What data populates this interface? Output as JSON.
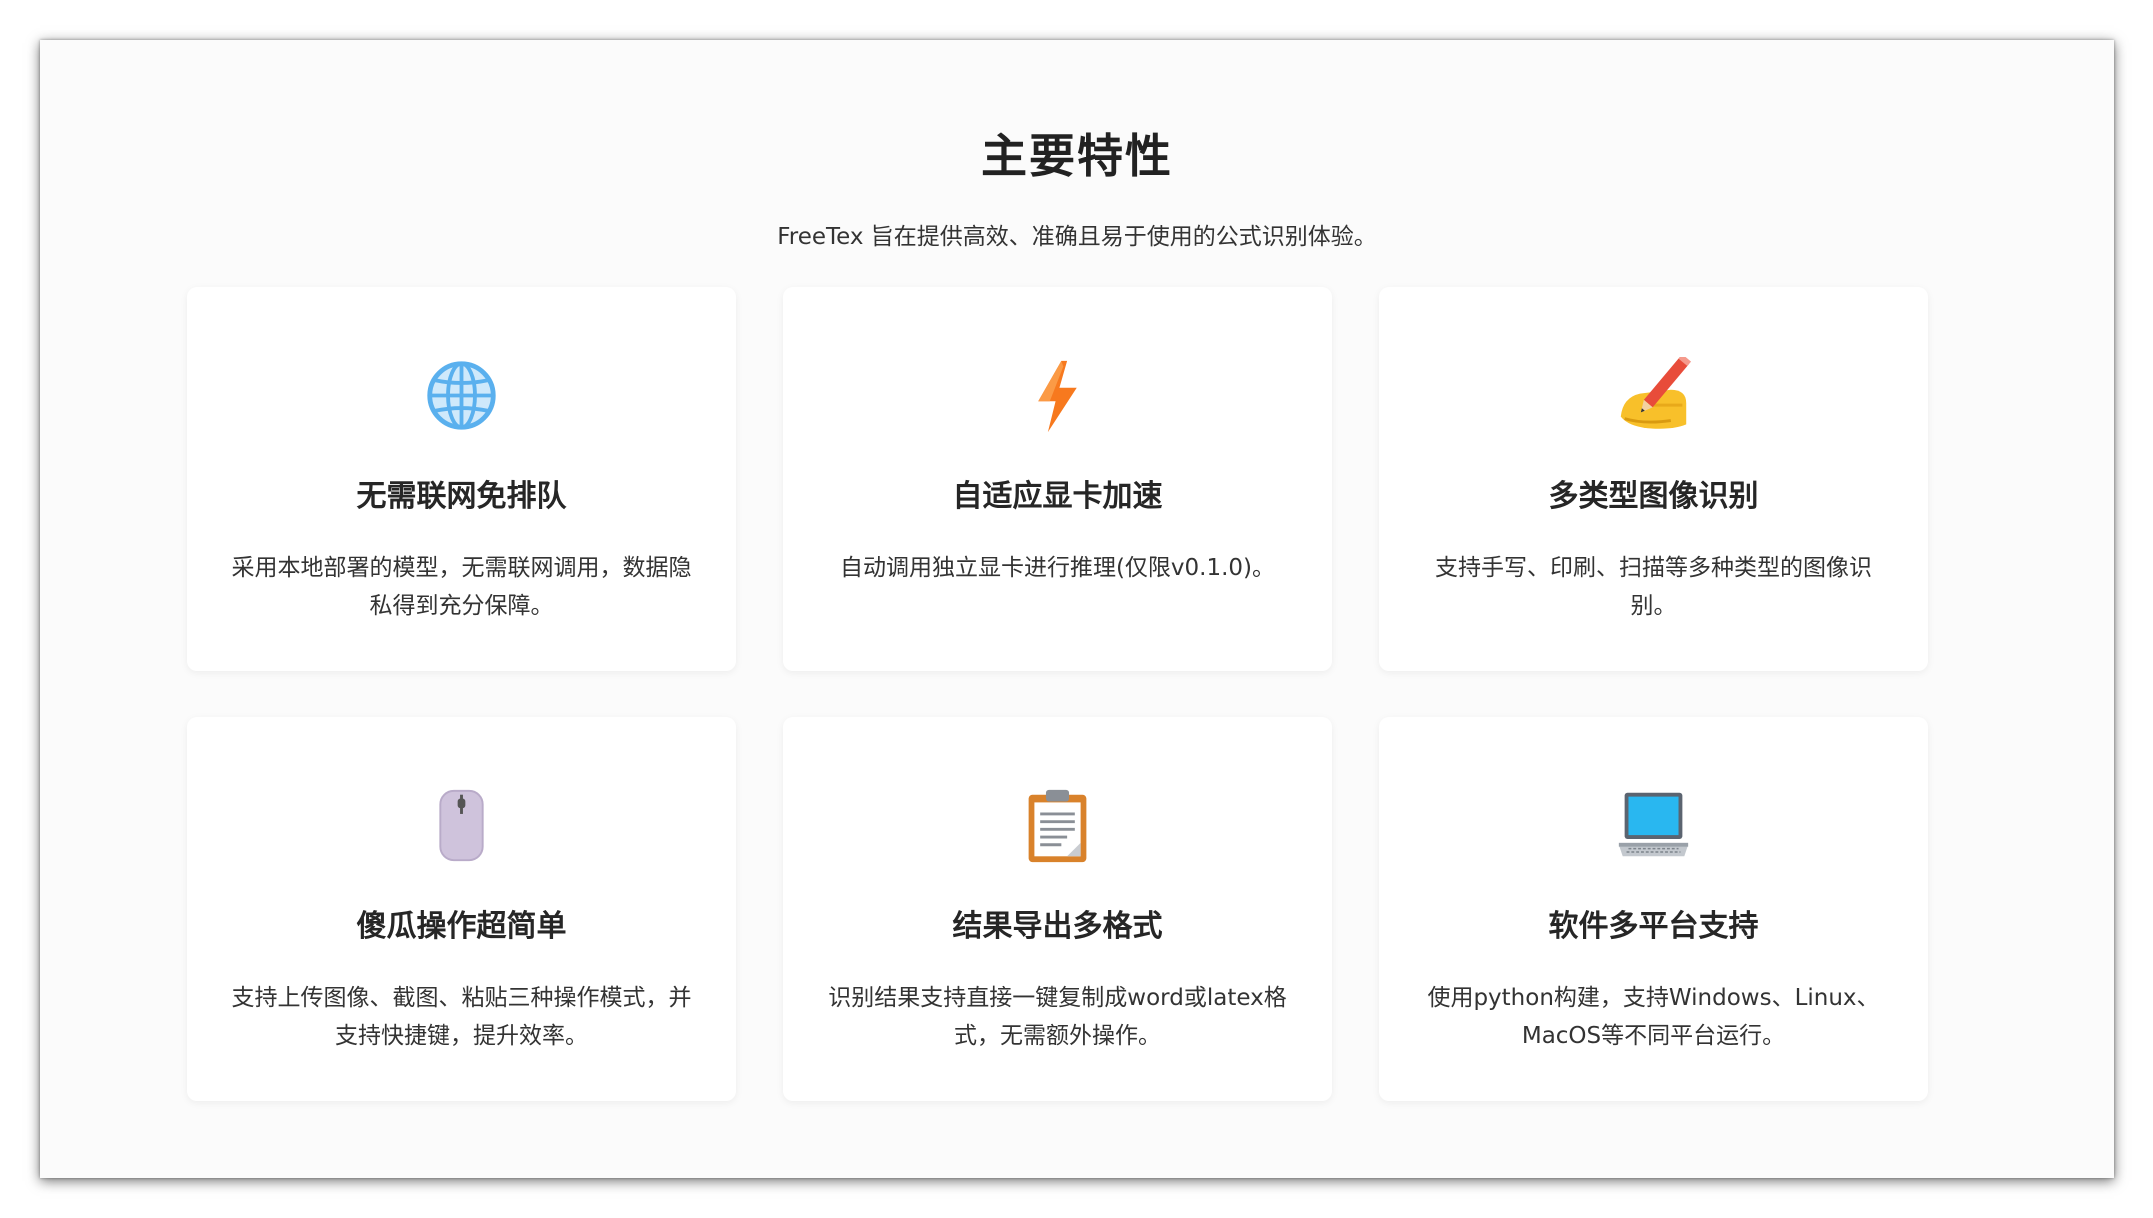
{
  "header": {
    "title": "主要特性",
    "subtitle": "FreeTex 旨在提供高效、准确且易于使用的公式识别体验。"
  },
  "features": [
    {
      "icon": "globe-icon",
      "title": "无需联网免排队",
      "description": "采用本地部署的模型，无需联网调用，数据隐私得到充分保障。"
    },
    {
      "icon": "lightning-icon",
      "title": "自适应显卡加速",
      "description": "自动调用独立显卡进行推理(仅限v0.1.0)。"
    },
    {
      "icon": "writing-hand-icon",
      "title": "多类型图像识别",
      "description": "支持手写、印刷、扫描等多种类型的图像识别。"
    },
    {
      "icon": "mouse-icon",
      "title": "傻瓜操作超简单",
      "description": "支持上传图像、截图、粘贴三种操作模式，并支持快捷键，提升效率。"
    },
    {
      "icon": "clipboard-icon",
      "title": "结果导出多格式",
      "description": "识别结果支持直接一键复制成word或latex格式，无需额外操作。"
    },
    {
      "icon": "laptop-icon",
      "title": "软件多平台支持",
      "description": "使用python构建，支持Windows、Linux、MacOS等不同平台运行。"
    }
  ]
}
